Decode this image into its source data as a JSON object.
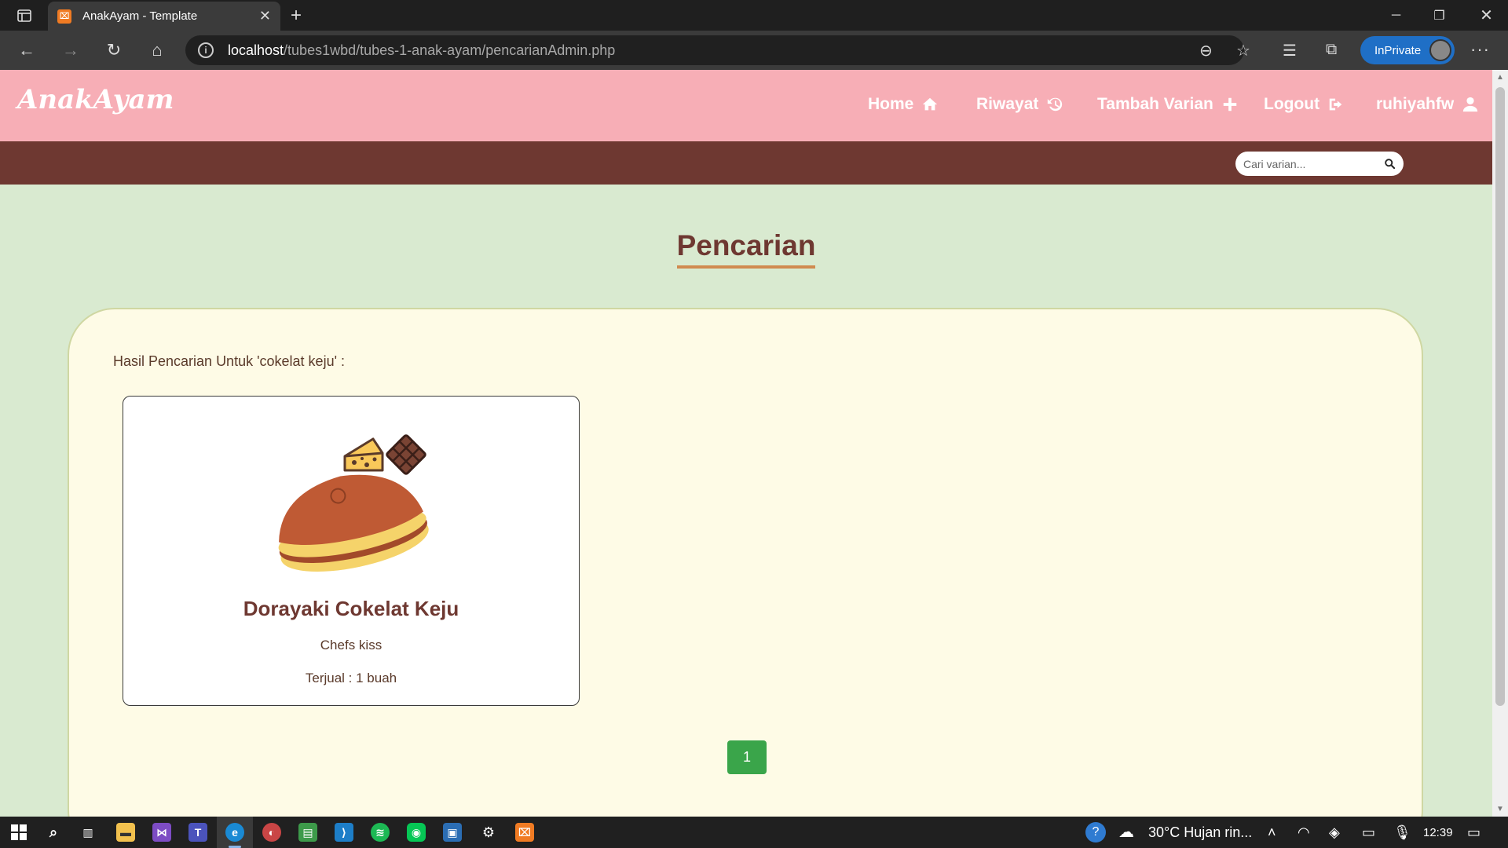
{
  "browser": {
    "tab_title": "AnakAyam - Template",
    "tab_favicon": "xampp-icon",
    "url_host": "localhost",
    "url_path": "/tubes1wbd/tubes-1-anak-ayam/pencarianAdmin.php",
    "inprivate_label": "InPrivate"
  },
  "navbar": {
    "brand": "AnakAyam",
    "links": [
      {
        "label": "Home",
        "icon": "home-icon"
      },
      {
        "label": "Riwayat",
        "icon": "history-icon"
      },
      {
        "label": "Tambah Varian",
        "icon": "plus-icon"
      },
      {
        "label": "Logout",
        "icon": "logout-icon"
      },
      {
        "label": "ruhiyahfw",
        "icon": "user-icon"
      }
    ],
    "color": "#f7aeb6"
  },
  "subnav": {
    "search_placeholder": "Cari varian...",
    "color": "#6e3831"
  },
  "main": {
    "heading": "Pencarian",
    "result_label": "Hasil Pencarian Untuk 'cokelat keju' :",
    "results": [
      {
        "name": "Dorayaki Cokelat Keju",
        "description": "Chefs kiss",
        "sold": "Terjual : 1 buah",
        "image": "dorayaki-cheese-chocolate-image"
      }
    ],
    "pagination": {
      "current": "1"
    }
  },
  "taskbar": {
    "weather": "30°C  Hujan rin...",
    "time": "12:39"
  }
}
